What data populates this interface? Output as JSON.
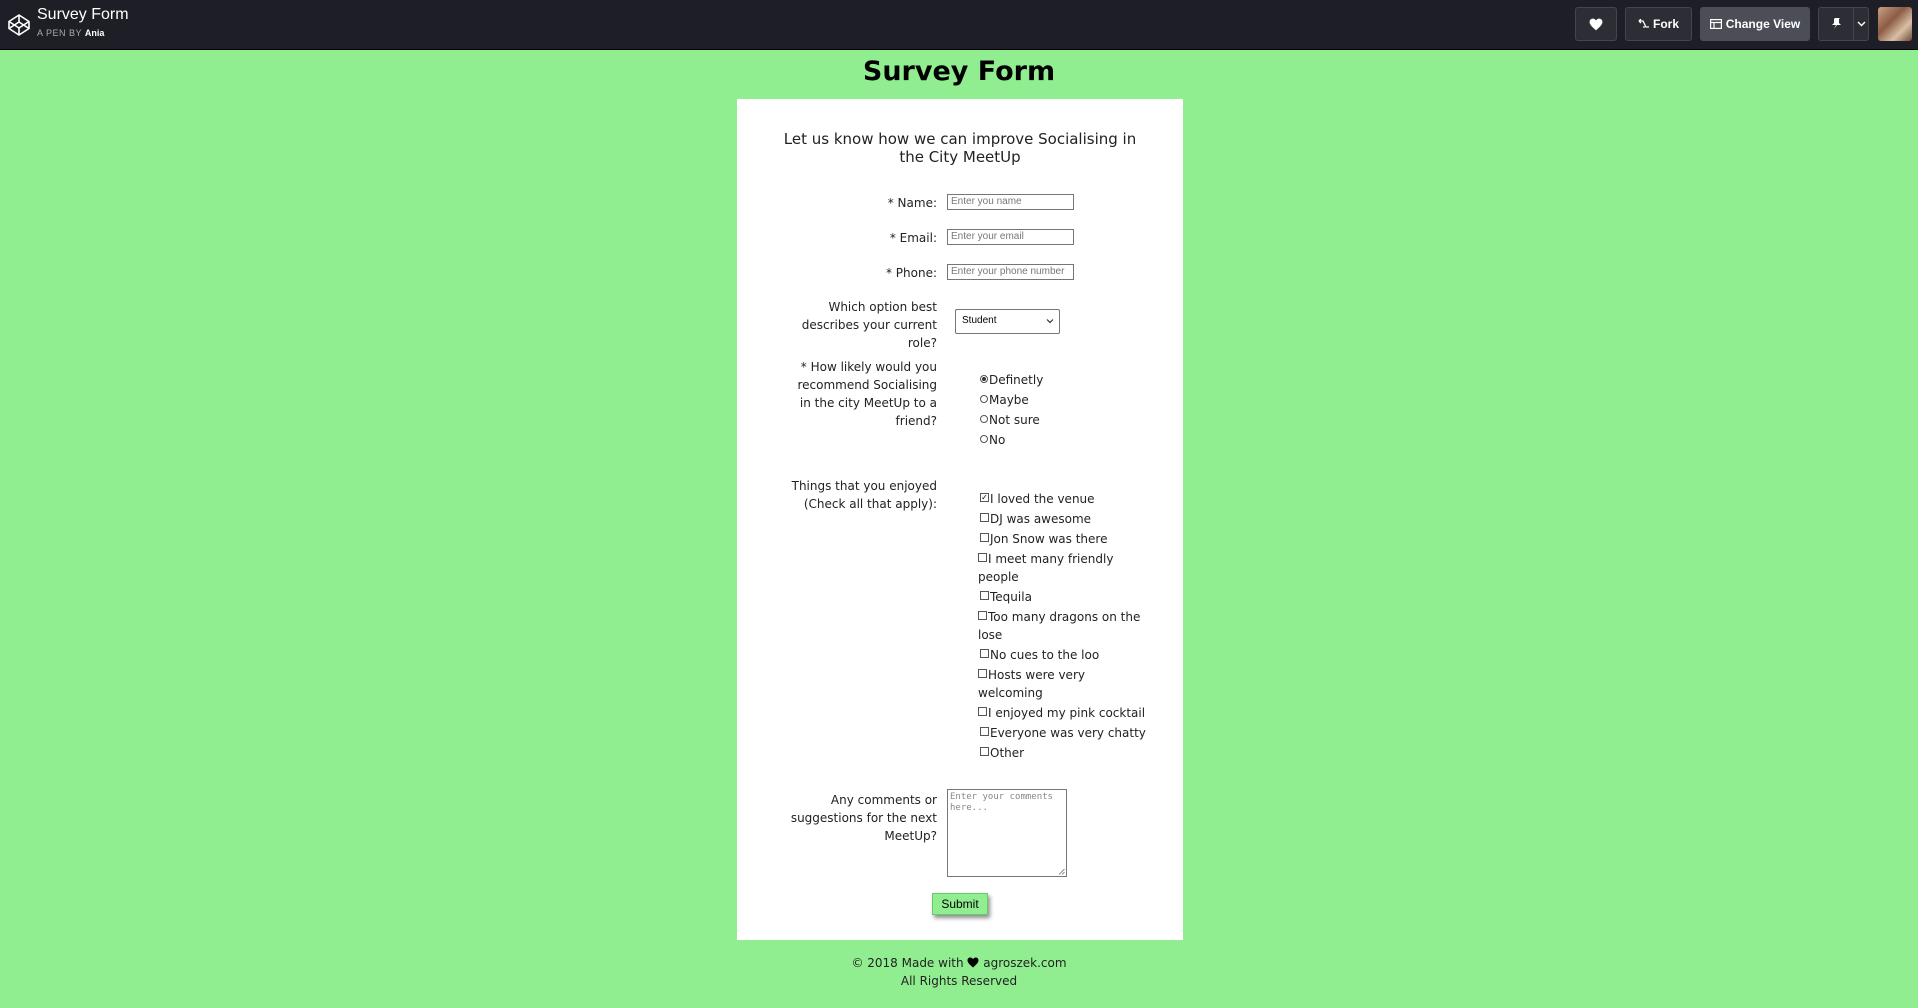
{
  "topbar": {
    "title": "Survey Form",
    "by_prefix": "A PEN BY",
    "author": "Ania",
    "fork_label": "Fork",
    "change_view_label": "Change View"
  },
  "page": {
    "heading": "Survey Form",
    "subtitle": "Let us know how we can improve Socialising in the City MeetUp"
  },
  "form": {
    "name": {
      "label": "* Name:",
      "placeholder": "Enter you name"
    },
    "email": {
      "label": "* Email:",
      "placeholder": "Enter your email"
    },
    "phone": {
      "label": "* Phone:",
      "placeholder": "Enter your phone number"
    },
    "role": {
      "label": "Which option best describes your current role?",
      "selected": "Student"
    },
    "recommend": {
      "label": "* How likely would you recommend Socialising in the city MeetUp to a friend?",
      "options": [
        "Definetly",
        "Maybe",
        "Not sure",
        "No"
      ],
      "selected_index": 0
    },
    "enjoyed": {
      "label": "Things that you enjoyed (Check all that apply):",
      "options": [
        "I loved the venue",
        "DJ was awesome",
        "Jon Snow was there",
        "I meet many friendly people",
        "Tequila",
        "Too many dragons on the lose",
        "No cues to the loo",
        "Hosts were very welcoming",
        "I enjoyed my pink cocktail",
        "Everyone was very chatty",
        "Other"
      ],
      "checked": [
        true,
        false,
        false,
        false,
        false,
        false,
        false,
        false,
        false,
        false,
        false
      ]
    },
    "comments": {
      "label": "Any comments or suggestions for the next MeetUp?",
      "placeholder": "Enter your comments here..."
    },
    "submit_label": "Submit"
  },
  "footer": {
    "line1_prefix": "© 2018 Made with",
    "line1_suffix": "agroszek.com",
    "line2": "All Rights Reserved"
  },
  "colors": {
    "background": "#90ee90",
    "topbar": "#1e1f26"
  }
}
